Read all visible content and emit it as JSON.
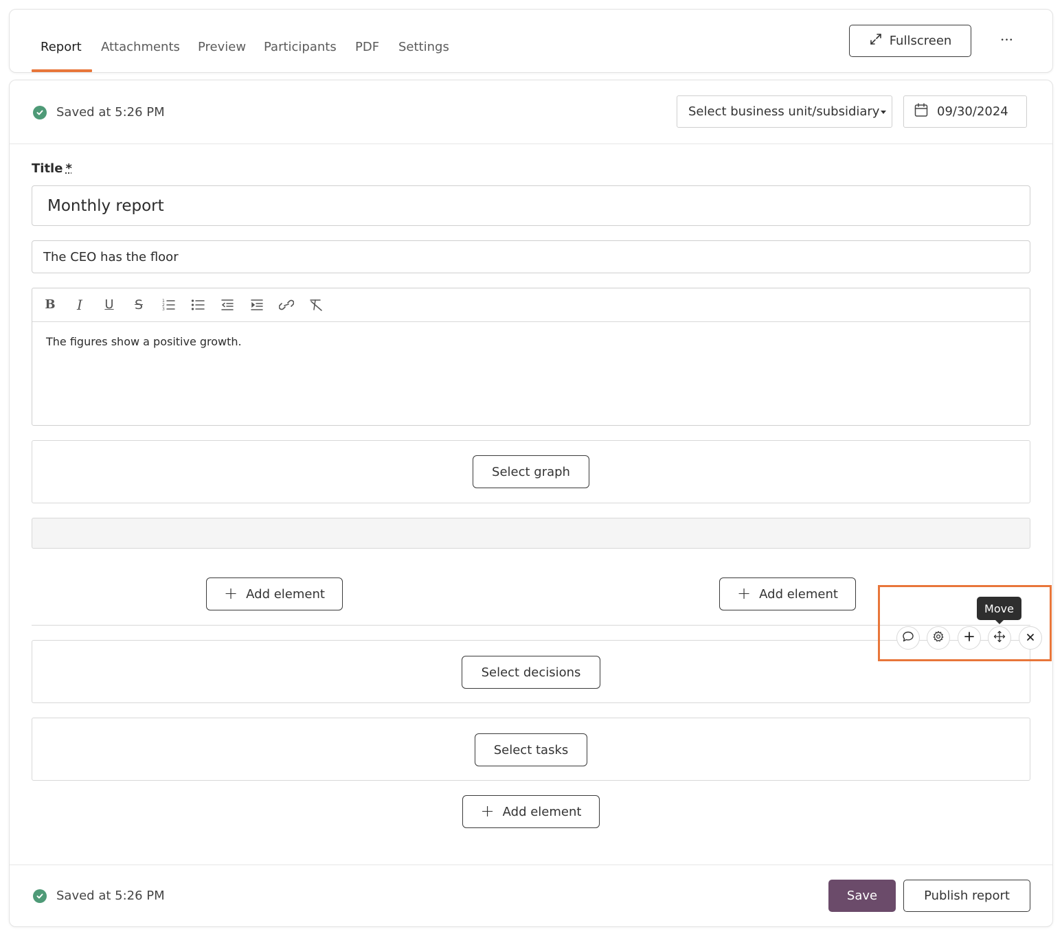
{
  "tabs": [
    {
      "label": "Report",
      "active": true
    },
    {
      "label": "Attachments",
      "active": false
    },
    {
      "label": "Preview",
      "active": false
    },
    {
      "label": "Participants",
      "active": false
    },
    {
      "label": "PDF",
      "active": false
    },
    {
      "label": "Settings",
      "active": false
    }
  ],
  "header_actions": {
    "fullscreen_label": "Fullscreen",
    "fullscreen_icon": "expand-icon",
    "more_icon": "more-horizontal-icon",
    "more_glyph": "•••"
  },
  "status": {
    "saved_text": "Saved at 5:26 PM",
    "icon": "check-circle-icon",
    "color": "#4e9a77"
  },
  "filters": {
    "business_unit_value": "Select business unit/subsidiary",
    "date_value": "09/30/2024",
    "date_icon": "calendar-icon"
  },
  "form": {
    "title_label": "Title",
    "title_required_mark": "*",
    "title_value": "Monthly report",
    "subtitle_value": "The CEO has the floor",
    "editor_toolbar": [
      "bold-icon",
      "italic-icon",
      "underline-icon",
      "strikethrough-icon",
      "ordered-list-icon",
      "bullet-list-icon",
      "outdent-icon",
      "indent-icon",
      "link-icon",
      "clear-format-icon"
    ],
    "editor_text": "The figures show a positive growth."
  },
  "blocks": {
    "select_graph": "Select graph",
    "select_decisions": "Select decisions",
    "select_tasks": "Select tasks",
    "add_element": "Add element"
  },
  "element_controls": {
    "tooltip": "Move",
    "icons": [
      "comment-icon",
      "settings-icon",
      "plus-icon",
      "move-icon",
      "close-icon"
    ]
  },
  "footer": {
    "saved_text": "Saved at 5:26 PM",
    "save_label": "Save",
    "publish_label": "Publish report"
  },
  "colors": {
    "accent": "#e8763a",
    "primary_button": "#6b4b6a",
    "success": "#4e9a77"
  }
}
